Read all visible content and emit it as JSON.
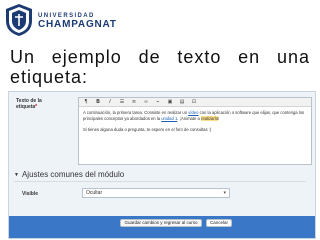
{
  "header": {
    "logo_line1": "UNIVERSIDAD",
    "logo_line2": "CHAMPAGNAT",
    "colors": {
      "brand": "#1d3b73",
      "bar": "#3a78c7"
    }
  },
  "slide": {
    "title": "Un ejemplo de texto en una etiqueta:"
  },
  "form": {
    "field_label_line1": "Texto de la",
    "field_label_line2": "etiqueta",
    "required_mark": "*",
    "editor": {
      "text_part1": "A continuación, la primera tarea. Consiste en realizar un ",
      "link_text": "vídeo",
      "text_part2": " con la aplicación o software que elijas, que contenga los principales conceptos ya abordados en la ",
      "link2_text": "unidad 1",
      "text_part3": ". ¡Animate a ",
      "highlight_text": "realizarlo",
      "text_part4": "!",
      "line2": "Si tienes alguna duda o pregunta, te espero en el foro de consultas :)",
      "toolbar_icons": [
        "text-style-icon",
        "bold-icon",
        "italic-icon",
        "bullet-list-icon",
        "numbered-list-icon",
        "link-icon",
        "unlink-icon",
        "image-icon",
        "media-icon",
        "fullscreen-icon"
      ]
    },
    "section_title": "Ajustes comunes del módulo",
    "visible_label": "Visible",
    "visible_value": "Ocultar",
    "save_button": "Guardar cambios y regresar al curso",
    "cancel_button": "Cancelar"
  }
}
